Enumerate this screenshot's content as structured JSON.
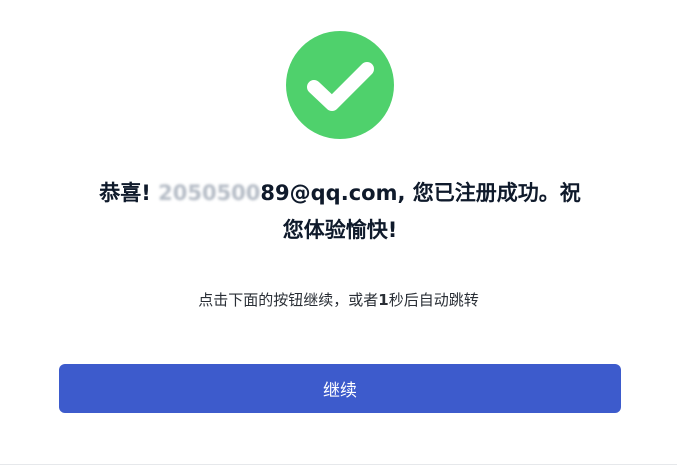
{
  "icon": {
    "name": "check-circle-icon",
    "background_color": "#4fd16c",
    "check_color": "#ffffff"
  },
  "message": {
    "prefix": "恭喜! ",
    "email_masked": "2050500",
    "email_visible": "89@qq.com",
    "suffix_line1": ", 您已注册成功。祝",
    "line2": "您体验愉快!"
  },
  "redirect": {
    "text_before": "点击下面的按钮继续，或者",
    "seconds": "1",
    "text_after": "秒后自动跳转"
  },
  "actions": {
    "continue_label": "继续"
  },
  "colors": {
    "accent": "#3d5bcc",
    "success": "#4fd16c",
    "heading": "#0f1a2b"
  }
}
